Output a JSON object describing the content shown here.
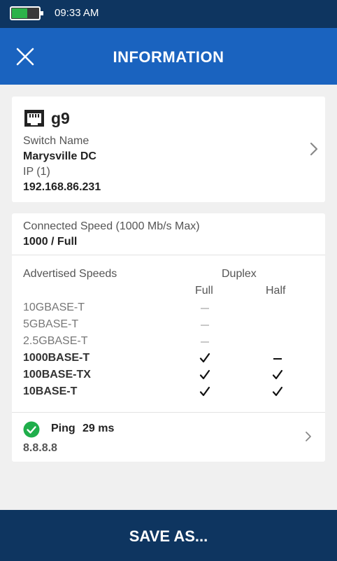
{
  "status_bar": {
    "time": "09:33 AM",
    "battery_level": 0.5,
    "battery_color": "#2db24a"
  },
  "header": {
    "title": "INFORMATION",
    "close_icon": "close-icon"
  },
  "switch_card": {
    "device_icon": "ethernet-port-icon",
    "device_name": "g9",
    "switch_name_label": "Switch Name",
    "switch_name": "Marysville DC",
    "ip_label": "IP (1)",
    "ip": "192.168.86.231"
  },
  "speed_card": {
    "connected_label": "Connected Speed (1000 Mb/s Max)",
    "connected_value": "1000 / Full",
    "advertised_label": "Advertised Speeds",
    "duplex_label": "Duplex",
    "full_label": "Full",
    "half_label": "Half",
    "speeds": [
      {
        "name": "10GBASE-T",
        "advertised": false,
        "full": "dash",
        "half": "none"
      },
      {
        "name": "5GBASE-T",
        "advertised": false,
        "full": "dash",
        "half": "none"
      },
      {
        "name": "2.5GBASE-T",
        "advertised": false,
        "full": "dash",
        "half": "none"
      },
      {
        "name": "1000BASE-T",
        "advertised": true,
        "full": "check",
        "half": "dash"
      },
      {
        "name": "100BASE-TX",
        "advertised": true,
        "full": "check",
        "half": "check"
      },
      {
        "name": "10BASE-T",
        "advertised": true,
        "full": "check",
        "half": "check"
      }
    ]
  },
  "ping": {
    "label": "Ping",
    "time": "29 ms",
    "host": "8.8.8.8",
    "status_color": "#1fae4b"
  },
  "footer": {
    "save_label": "SAVE AS..."
  },
  "colors": {
    "header": "#1a63bf",
    "bars": "#0e3560",
    "background": "#f0f0f0"
  }
}
